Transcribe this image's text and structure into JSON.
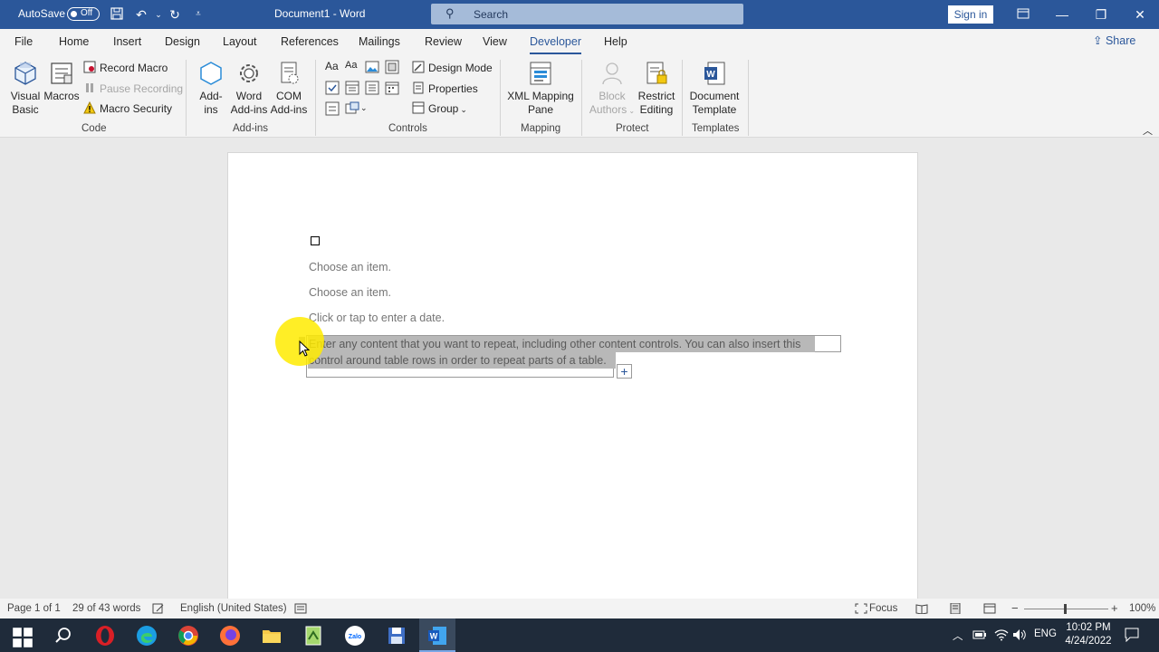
{
  "titlebar": {
    "autosave_label": "AutoSave",
    "autosave_state": "Off",
    "title": "Document1  -  Word",
    "search_placeholder": "Search",
    "signin": "Sign in"
  },
  "tabs": [
    "File",
    "Home",
    "Insert",
    "Design",
    "Layout",
    "References",
    "Mailings",
    "Review",
    "View",
    "Developer",
    "Help"
  ],
  "active_tab": "Developer",
  "share_label": "Share",
  "ribbon": {
    "code": {
      "visual_basic": [
        "Visual",
        "Basic"
      ],
      "macros": "Macros",
      "record_macro": "Record Macro",
      "pause_recording": "Pause Recording",
      "macro_security": "Macro Security",
      "group_label": "Code"
    },
    "addins": {
      "addins": [
        "Add-",
        "ins"
      ],
      "word_addins": [
        "Word",
        "Add-ins"
      ],
      "com_addins": [
        "COM",
        "Add-ins"
      ],
      "group_label": "Add-ins"
    },
    "controls": {
      "design_mode": "Design Mode",
      "properties": "Properties",
      "group": "Group",
      "group_label": "Controls"
    },
    "mapping": {
      "xml_mapping": [
        "XML Mapping",
        "Pane"
      ],
      "group_label": "Mapping"
    },
    "protect": {
      "block_authors": [
        "Block",
        "Authors"
      ],
      "restrict_editing": [
        "Restrict",
        "Editing"
      ],
      "group_label": "Protect"
    },
    "templates": {
      "document_template": [
        "Document",
        "Template"
      ],
      "group_label": "Templates"
    }
  },
  "document": {
    "choose1": "Choose an item.",
    "choose2": "Choose an item.",
    "date": "Click or tap to enter a date.",
    "repeat_line1": "Enter any content that you want to repeat, including other content controls. You can also insert this",
    "repeat_line2": "control around table rows in order to repeat parts of a table."
  },
  "statusbar": {
    "page": "Page 1 of 1",
    "words": "29 of 43 words",
    "language": "English (United States)",
    "focus": "Focus",
    "zoom": "100%"
  },
  "taskbar": {
    "lang": "ENG",
    "time": "10:02 PM",
    "date": "4/24/2022"
  },
  "colors": {
    "title_blue": "#2b579a",
    "taskbar": "#1f2b3a",
    "highlight": "#ffeb00"
  }
}
